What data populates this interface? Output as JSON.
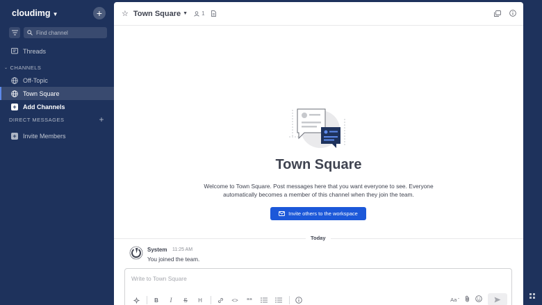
{
  "team": {
    "name": "cloudimg"
  },
  "search": {
    "placeholder": "Find channel"
  },
  "sidebar": {
    "threads_label": "Threads",
    "channels_header": "CHANNELS",
    "channels": [
      {
        "label": "Off-Topic"
      },
      {
        "label": "Town Square"
      }
    ],
    "add_channels_label": "Add Channels",
    "dm_header": "DIRECT MESSAGES",
    "invite_members_label": "Invite Members"
  },
  "header": {
    "channel_name": "Town Square",
    "member_count": "1"
  },
  "intro": {
    "title": "Town Square",
    "description": "Welcome to Town Square. Post messages here that you want everyone to see. Everyone automatically becomes a member of this channel when they join the team.",
    "invite_button": "Invite others to the workspace"
  },
  "divider": {
    "label": "Today"
  },
  "post": {
    "author": "System",
    "time": "11:25 AM",
    "message": "You joined the team."
  },
  "composer": {
    "placeholder": "Write to Town Square",
    "format_bold": "B",
    "format_italic": "I",
    "format_strike": "S",
    "format_heading": "H",
    "format_code": "<>",
    "format_quote": "““",
    "font_toggle": "Aa"
  },
  "colors": {
    "sidebar_bg": "#1e325c",
    "accent": "#1c58d9",
    "active_border": "#5d89ea",
    "text": "#3f4350"
  }
}
